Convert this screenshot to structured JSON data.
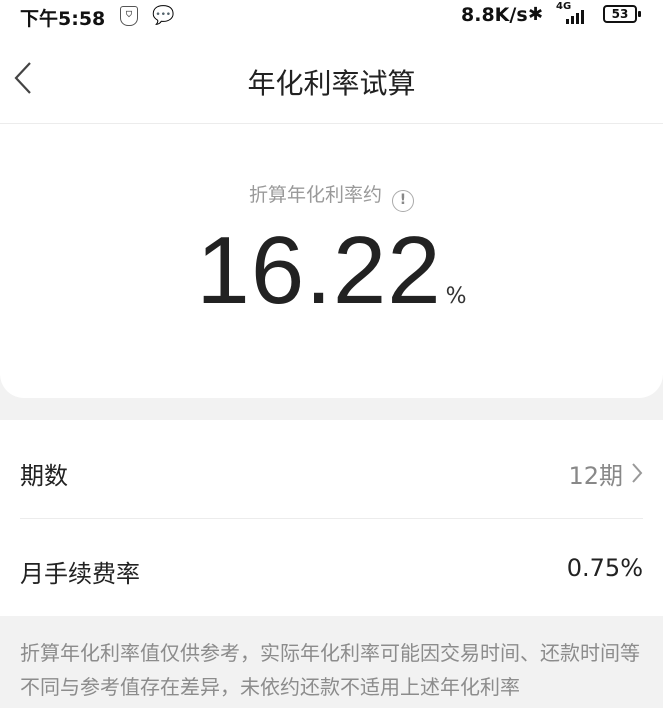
{
  "status_bar": {
    "time": "下午5:58",
    "network_speed": "8.8K/s",
    "network_type": "4G",
    "battery": "53"
  },
  "nav": {
    "title": "年化利率试算"
  },
  "result": {
    "label": "折算年化利率约",
    "info_glyph": "!",
    "value": "16.22",
    "unit": "%"
  },
  "params": {
    "periods_label": "期数",
    "periods_value": "12期",
    "fee_label": "月手续费率",
    "fee_value": "0.75%"
  },
  "disclaimer": "折算年化利率值仅供参考，实际年化利率可能因交易时间、还款时间等不同与参考值存在差异，未依约还款不适用上述年化利率"
}
